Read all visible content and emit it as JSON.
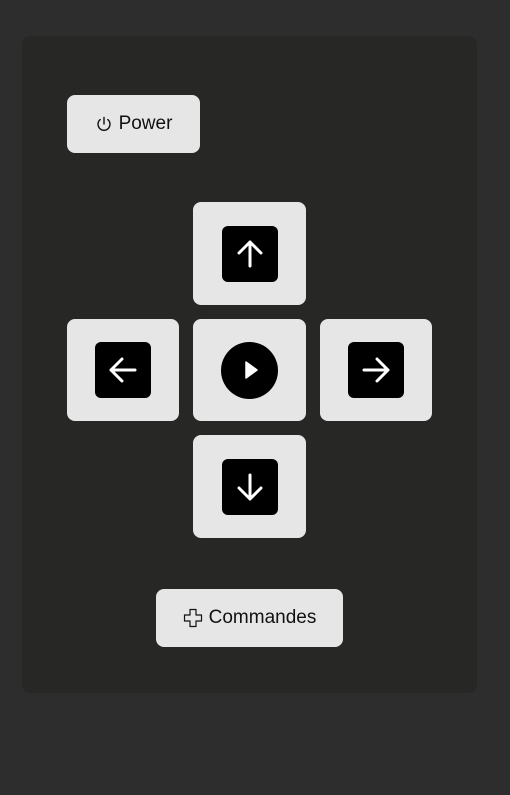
{
  "power": {
    "label": "Power",
    "icon": "power-icon"
  },
  "dpad": {
    "up_icon": "arrow-up-icon",
    "left_icon": "arrow-left-icon",
    "center_icon": "play-icon",
    "right_icon": "arrow-right-icon",
    "down_icon": "arrow-down-icon"
  },
  "commandes": {
    "label": "Commandes",
    "icon": "gamepad-cross-icon"
  },
  "colors": {
    "background": "#2d2d2d",
    "panel": "#272726",
    "button": "#e6e6e6",
    "icon_bg": "#000000",
    "icon_fg": "#ffffff"
  }
}
